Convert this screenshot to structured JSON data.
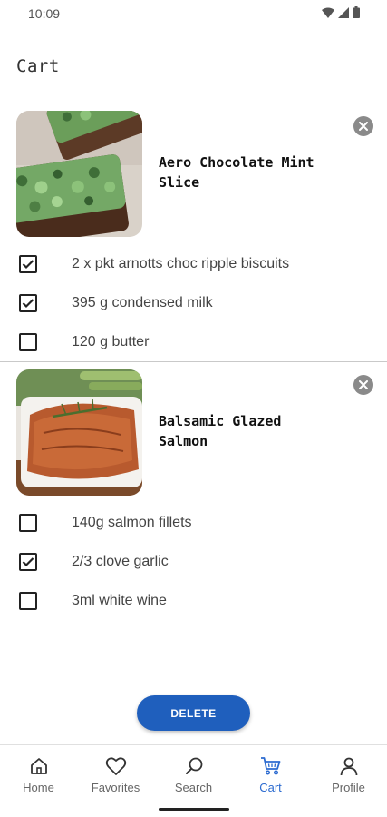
{
  "status_bar": {
    "time": "10:09"
  },
  "page": {
    "title": "Cart"
  },
  "recipes": [
    {
      "name_line1": "Aero Chocolate Mint",
      "name_line2": "Slice",
      "ingredients": [
        {
          "text": "2 x pkt arnotts choc ripple biscuits",
          "checked": true
        },
        {
          "text": "395 g condensed milk",
          "checked": true
        },
        {
          "text": "120 g butter",
          "checked": false
        }
      ]
    },
    {
      "name_line1": "Balsamic Glazed",
      "name_line2": "Salmon",
      "ingredients": [
        {
          "text": "140g salmon fillets",
          "checked": false
        },
        {
          "text": "2/3 clove garlic",
          "checked": true
        },
        {
          "text": "3ml white wine",
          "checked": false
        }
      ]
    }
  ],
  "actions": {
    "delete_label": "DELETE"
  },
  "bottom_nav": {
    "items": [
      {
        "label": "Home",
        "icon": "home-icon"
      },
      {
        "label": "Favorites",
        "icon": "heart-icon"
      },
      {
        "label": "Search",
        "icon": "search-icon"
      },
      {
        "label": "Cart",
        "icon": "cart-icon",
        "active": true
      },
      {
        "label": "Profile",
        "icon": "person-icon"
      }
    ]
  },
  "colors": {
    "accent": "#1f5fbd",
    "nav_active": "#2c6bd0"
  }
}
